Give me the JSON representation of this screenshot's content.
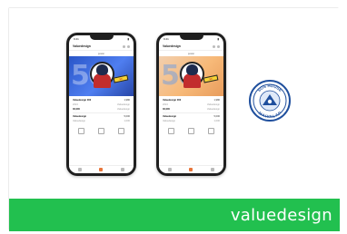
{
  "phones": [
    {
      "status_time": "9:41",
      "title": "Valuedesign",
      "subtitle": "poster",
      "banner_number": "50",
      "flag_text": "50",
      "rows": [
        {
          "label": "Valuedesign 000",
          "value": "1,980"
        },
        {
          "label": "2024",
          "value": "Valuedesign"
        },
        {
          "label": "30,000",
          "value": "Valuedesign"
        }
      ],
      "rows2": [
        {
          "label": "Valuedesign",
          "value": "5,000"
        },
        {
          "label": "Valuedesign",
          "value": "1,000"
        }
      ],
      "theme": "blue"
    },
    {
      "status_time": "9:41",
      "title": "Valuedesign",
      "subtitle": "poster",
      "banner_number": "50",
      "flag_text": "50",
      "rows": [
        {
          "label": "Valuedesign 000",
          "value": "1,980"
        },
        {
          "label": "2024",
          "value": "Valuedesign"
        },
        {
          "label": "30,000",
          "value": "Valuedesign"
        }
      ],
      "rows2": [
        {
          "label": "Valuedesign",
          "value": "5,000"
        },
        {
          "label": "Valuedesign",
          "value": "1,000"
        }
      ],
      "theme": "orange"
    }
  ],
  "badge": {
    "top_text": "SOS HOUSE",
    "bottom_text": "MAIVALAP",
    "color": "#1f4f9d"
  },
  "footer": {
    "brand": "valuedesign",
    "color": "#22c04f"
  }
}
